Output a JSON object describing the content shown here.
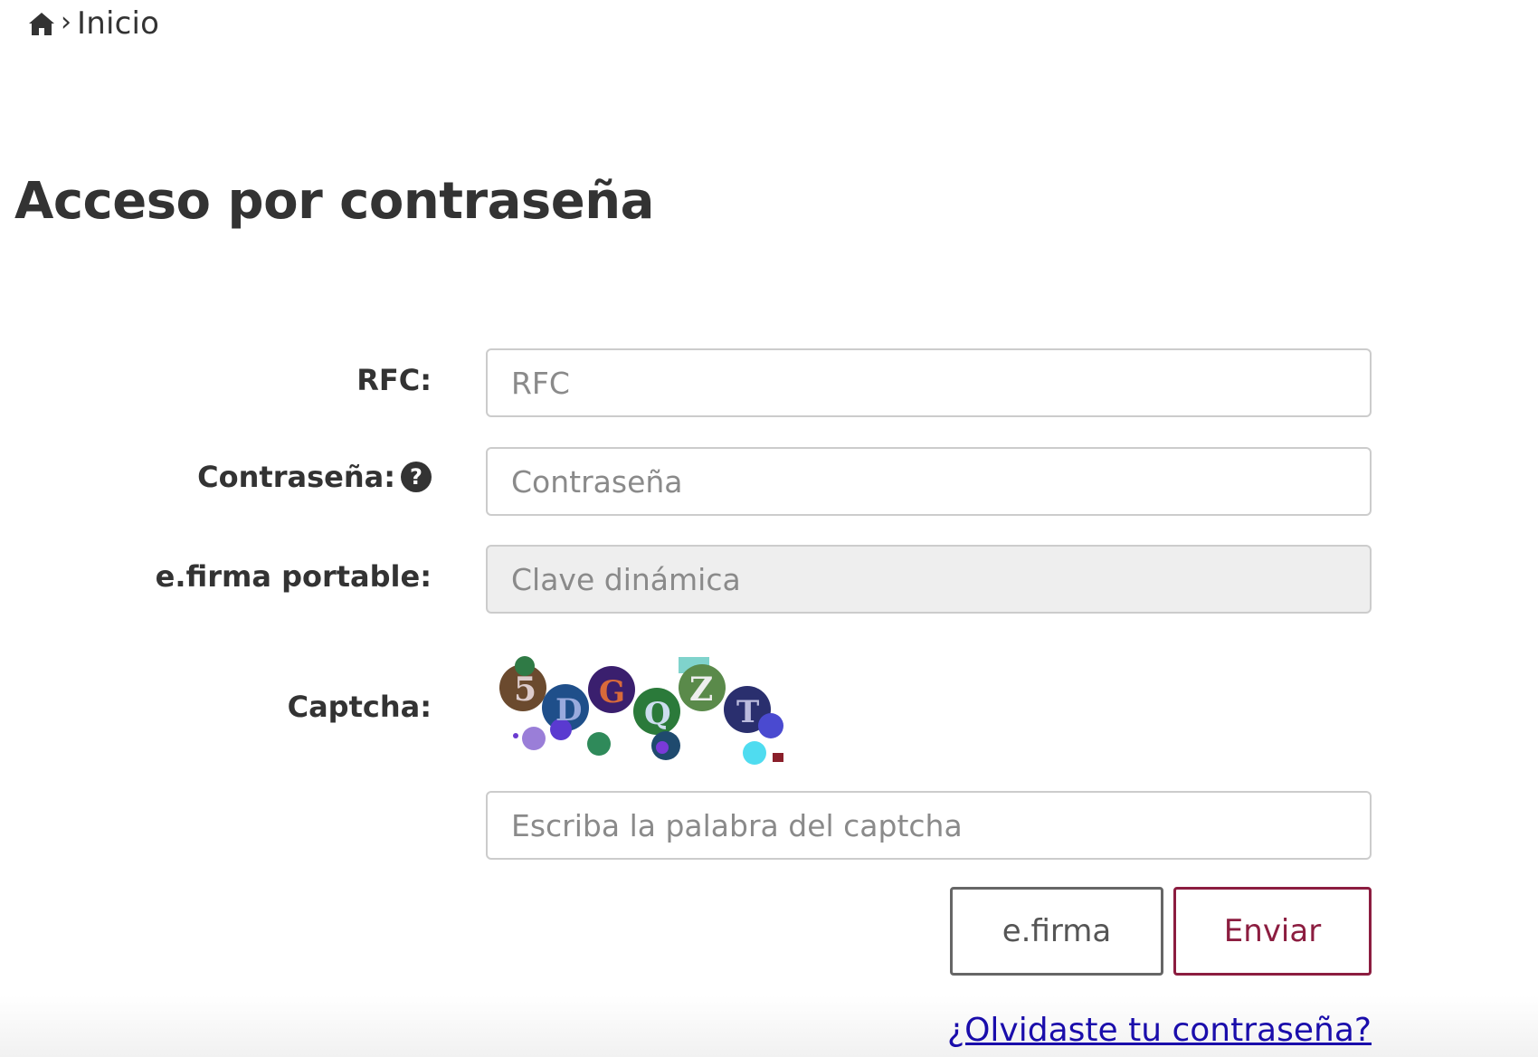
{
  "breadcrumb": {
    "home_icon": "home-icon",
    "separator": "›",
    "current": "Inicio"
  },
  "page": {
    "title": "Acceso por contraseña"
  },
  "form": {
    "rfc": {
      "label": "RFC:",
      "placeholder": "RFC",
      "value": ""
    },
    "password": {
      "label": "Contraseña:",
      "placeholder": "Contraseña",
      "value": "",
      "help_icon": "question-circle-icon"
    },
    "efirma_portable": {
      "label": "e.firma portable:",
      "placeholder": "Clave dinámica",
      "disabled": true
    },
    "captcha": {
      "label": "Captcha:",
      "input_placeholder": "Escriba la palabra del captcha",
      "characters": [
        "5",
        "D",
        "G",
        "Q",
        "Z",
        "T"
      ]
    }
  },
  "buttons": {
    "efirma": "e.firma",
    "submit": "Enviar"
  },
  "links": {
    "forgot_password": "¿Olvidaste tu contraseña?"
  },
  "colors": {
    "accent": "#8c1d40",
    "link": "#1a0dab",
    "text": "#333333",
    "border": "#cccccc",
    "disabled_bg": "#eeeeee"
  }
}
